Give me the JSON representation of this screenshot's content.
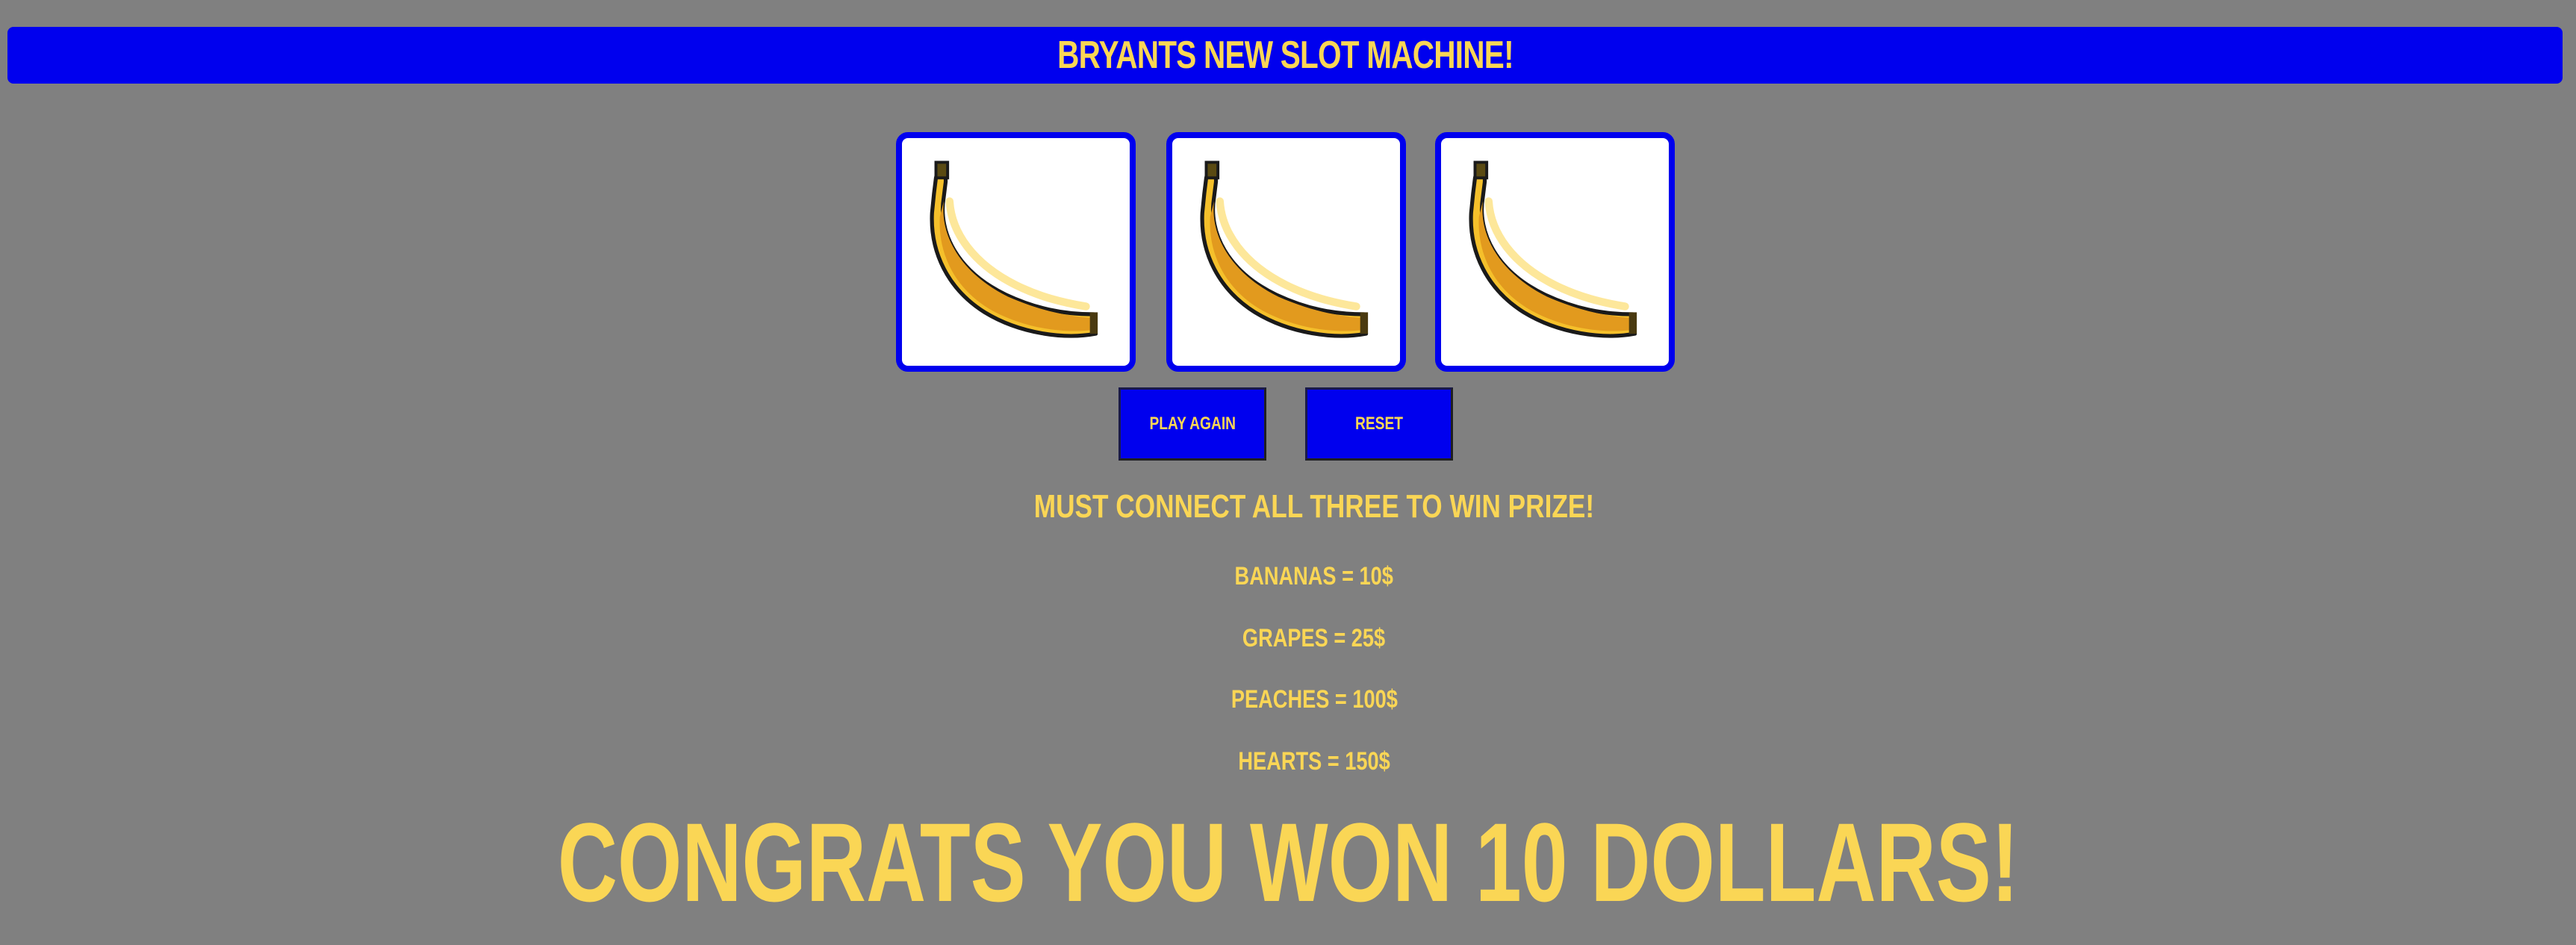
{
  "header": {
    "title": "BRYANTS NEW SLOT MACHINE!"
  },
  "reels": [
    {
      "symbol": "banana-icon"
    },
    {
      "symbol": "banana-icon"
    },
    {
      "symbol": "banana-icon"
    }
  ],
  "buttons": {
    "play_again": "PLAY AGAIN",
    "reset": "RESET"
  },
  "rules": {
    "headline": "MUST CONNECT ALL THREE TO WIN PRIZE!",
    "prizes": [
      "BANANAS = 10$",
      "GRAPES = 25$",
      "PEACHES = 100$",
      "HEARTS = 150$"
    ]
  },
  "result": {
    "message": "CONGRATS YOU WON 10 DOLLARS!"
  },
  "colors": {
    "background": "#808080",
    "accent_blue": "#0000ee",
    "text_yellow": "#fad655",
    "reel_background": "#ffffff"
  }
}
